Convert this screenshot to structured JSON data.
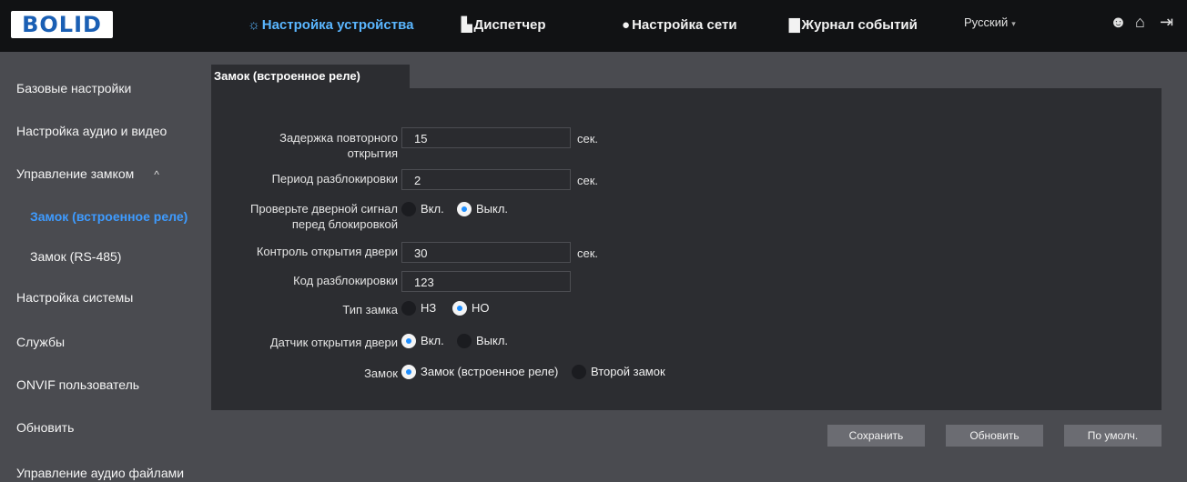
{
  "header": {
    "logo": "BOLID",
    "nav": [
      {
        "icon": "☼",
        "label": "Настройка устройства"
      },
      {
        "icon": "▙",
        "label": "Диспетчер"
      },
      {
        "icon": "●",
        "label": "Настройка сети"
      },
      {
        "icon": "▇",
        "label": "Журнал событий"
      }
    ],
    "language": "Русский",
    "icons": [
      "user-icon",
      "home-icon",
      "logout-icon"
    ]
  },
  "sidebar": {
    "items": [
      {
        "label": "Базовые настройки"
      },
      {
        "label": "Настройка аудио и видео"
      },
      {
        "label": "Управление замком"
      },
      {
        "label": "Замок (встроенное реле)"
      },
      {
        "label": "Замок (RS-485)"
      },
      {
        "label": "Настройка системы"
      },
      {
        "label": "Службы"
      },
      {
        "label": "ONVIF пользователь"
      },
      {
        "label": "Обновить"
      },
      {
        "label": "Управление аудио файлами"
      }
    ]
  },
  "tab": {
    "label": "Замок (встроенное реле)"
  },
  "form": {
    "relock_delay": {
      "label_1": "Задержка повторного",
      "label_2": "открытия",
      "value": "15",
      "unit": "сек."
    },
    "unlock_period": {
      "label": "Период разблокировки",
      "value": "2",
      "unit": "сек."
    },
    "check_door_signal": {
      "label_1": "Проверьте дверной сигнал",
      "label_2": "перед блокировкой",
      "on": "Вкл.",
      "off": "Выкл.",
      "selected": "off"
    },
    "door_open_control": {
      "label": "Контроль открытия двери",
      "value": "30",
      "unit": "сек."
    },
    "unlock_code": {
      "label": "Код разблокировки",
      "value": "123"
    },
    "lock_type": {
      "label": "Тип замка",
      "nc": "НЗ",
      "no": "НО",
      "selected": "no"
    },
    "door_sensor": {
      "label": "Датчик открытия двери",
      "on": "Вкл.",
      "off": "Выкл.",
      "selected": "on"
    },
    "lock": {
      "label": "Замок",
      "builtin": "Замок (встроенное реле)",
      "second": "Второй замок",
      "selected": "builtin"
    }
  },
  "buttons": {
    "save": "Сохранить",
    "refresh": "Обновить",
    "default": "По умолч."
  },
  "colors": {
    "accent": "#3e9bff",
    "topbar": "#111214",
    "panel": "#2c2d31",
    "background": "#4a4b50"
  }
}
